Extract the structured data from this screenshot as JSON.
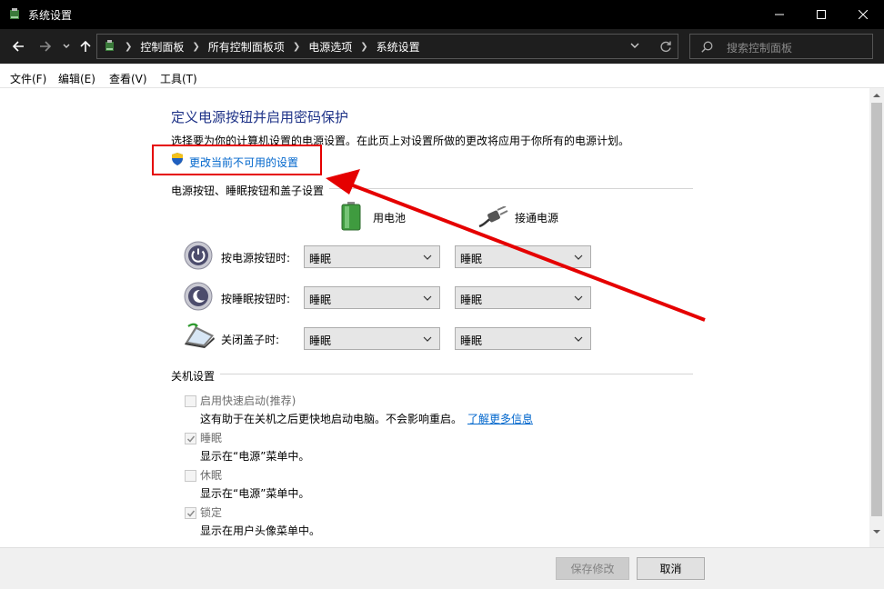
{
  "window": {
    "title": "系统设置",
    "controls": {
      "minimize": "minimize-icon",
      "maximize": "maximize-icon",
      "close": "close-icon"
    }
  },
  "address_bar": {
    "breadcrumbs": [
      "控制面板",
      "所有控制面板项",
      "电源选项",
      "系统设置"
    ]
  },
  "search": {
    "placeholder": "搜索控制面板"
  },
  "menu": [
    "文件(F)",
    "编辑(E)",
    "查看(V)",
    "工具(T)"
  ],
  "content": {
    "heading": "定义电源按钮并启用密码保护",
    "description": "选择要为你的计算机设置的电源设置。在此页上对设置所做的更改将应用于你所有的电源计划。",
    "change_link": "更改当前不可用的设置",
    "section_buttons": "电源按钮、睡眠按钮和盖子设置",
    "col_battery": "用电池",
    "col_plugged": "接通电源",
    "rows": [
      {
        "label": "按电源按钮时:",
        "battery": "睡眠",
        "plugged": "睡眠"
      },
      {
        "label": "按睡眠按钮时:",
        "battery": "睡眠",
        "plugged": "睡眠"
      },
      {
        "label": "关闭盖子时:",
        "battery": "睡眠",
        "plugged": "睡眠"
      }
    ],
    "section_shutdown": "关机设置",
    "shutdown_options": [
      {
        "label": "启用快速启动(推荐)",
        "desc": "这有助于在关机之后更快地启动电脑。不会影响重启。",
        "link": "了解更多信息",
        "checked": false
      },
      {
        "label": "睡眠",
        "desc": "显示在“电源”菜单中。",
        "checked": true
      },
      {
        "label": "休眠",
        "desc": "显示在“电源”菜单中。",
        "checked": false
      },
      {
        "label": "锁定",
        "desc": "显示在用户头像菜单中。",
        "checked": true
      }
    ]
  },
  "footer": {
    "save": "保存修改",
    "cancel": "取消"
  },
  "colors": {
    "heading": "#1e3287",
    "link": "#0066cc",
    "annotation": "#e50000"
  }
}
